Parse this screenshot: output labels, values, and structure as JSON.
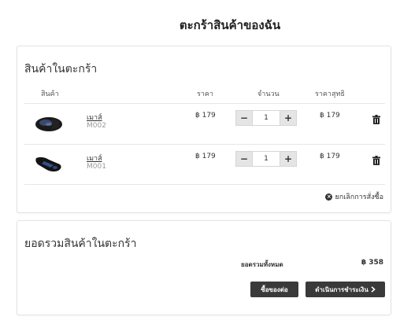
{
  "page": {
    "title": "ตะกร้าสินค้าของฉัน"
  },
  "cart": {
    "title": "สินค้าในตะกร้า",
    "columns": {
      "product": "สินค้า",
      "price": "ราคา",
      "quantity": "จำนวน",
      "net_price": "ราคาสุทธิ"
    },
    "items": [
      {
        "name": "เมาส์",
        "sku": "M002",
        "price": "฿ 179",
        "quantity": "1",
        "net": "฿ 179"
      },
      {
        "name": "เมาส์",
        "sku": "M001",
        "price": "฿ 179",
        "quantity": "1",
        "net": "฿ 179"
      }
    ],
    "cancel_label": "ยกเลิกการสั่งซื้อ"
  },
  "summary": {
    "title": "ยอดรวมสินค้าในตะกร้า",
    "total_label": "ยอดรวมทั้งหมด",
    "total_value": "฿ 358",
    "continue_label": "ซื้อของต่อ",
    "checkout_label": "ดำเนินการชำระเงิน"
  },
  "icons": {
    "minus": "minus-icon",
    "plus": "plus-icon",
    "trash": "trash-icon",
    "cancel": "x-circle-icon",
    "chevron": "chevron-right-icon",
    "product_image": "gaming-mouse-image"
  }
}
